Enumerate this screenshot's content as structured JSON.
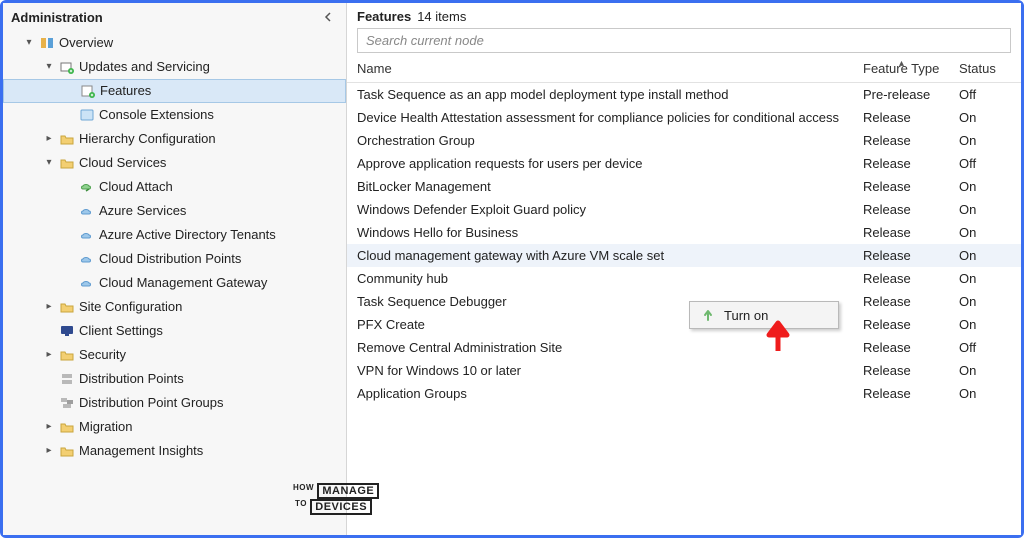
{
  "sidebar": {
    "title": "Administration",
    "tree": {
      "overview": "Overview",
      "updates_servicing": "Updates and Servicing",
      "features": "Features",
      "console_extensions": "Console Extensions",
      "hierarchy_config": "Hierarchy Configuration",
      "cloud_services": "Cloud Services",
      "cloud_attach": "Cloud Attach",
      "azure_services": "Azure Services",
      "azure_ad_tenants": "Azure Active Directory Tenants",
      "cloud_dist_points": "Cloud Distribution Points",
      "cloud_mgmt_gateway": "Cloud Management Gateway",
      "site_config": "Site Configuration",
      "client_settings": "Client Settings",
      "security": "Security",
      "dist_points": "Distribution Points",
      "dist_point_groups": "Distribution Point Groups",
      "migration": "Migration",
      "management_insights": "Management Insights"
    }
  },
  "main": {
    "title": "Features",
    "count_label": "14 items",
    "search_placeholder": "Search current node",
    "columns": {
      "name": "Name",
      "type": "Feature Type",
      "status": "Status"
    },
    "rows": [
      {
        "name": "Task Sequence as an app model deployment type install method",
        "type": "Pre-release",
        "status": "Off"
      },
      {
        "name": "Device Health Attestation assessment for compliance policies for conditional access",
        "type": "Release",
        "status": "On"
      },
      {
        "name": "Orchestration Group",
        "type": "Release",
        "status": "On"
      },
      {
        "name": "Approve application requests for users per device",
        "type": "Release",
        "status": "Off"
      },
      {
        "name": "BitLocker Management",
        "type": "Release",
        "status": "On"
      },
      {
        "name": "Windows Defender Exploit Guard policy",
        "type": "Release",
        "status": "On"
      },
      {
        "name": "Windows Hello for Business",
        "type": "Release",
        "status": "On"
      },
      {
        "name": "Cloud management gateway with Azure VM scale set",
        "type": "Release",
        "status": "On"
      },
      {
        "name": "Community hub",
        "type": "Release",
        "status": "On"
      },
      {
        "name": "Task Sequence Debugger",
        "type": "Release",
        "status": "On"
      },
      {
        "name": "PFX Create",
        "type": "Release",
        "status": "On"
      },
      {
        "name": "Remove Central Administration Site",
        "type": "Release",
        "status": "Off"
      },
      {
        "name": "VPN for Windows 10 or later",
        "type": "Release",
        "status": "On"
      },
      {
        "name": "Application Groups",
        "type": "Release",
        "status": "On"
      }
    ],
    "context_menu": {
      "turn_on": "Turn on"
    }
  },
  "watermark": {
    "line1a": "HOW",
    "line1b": "MANAGE",
    "line1c": "TO",
    "line2": "DEVICES"
  }
}
